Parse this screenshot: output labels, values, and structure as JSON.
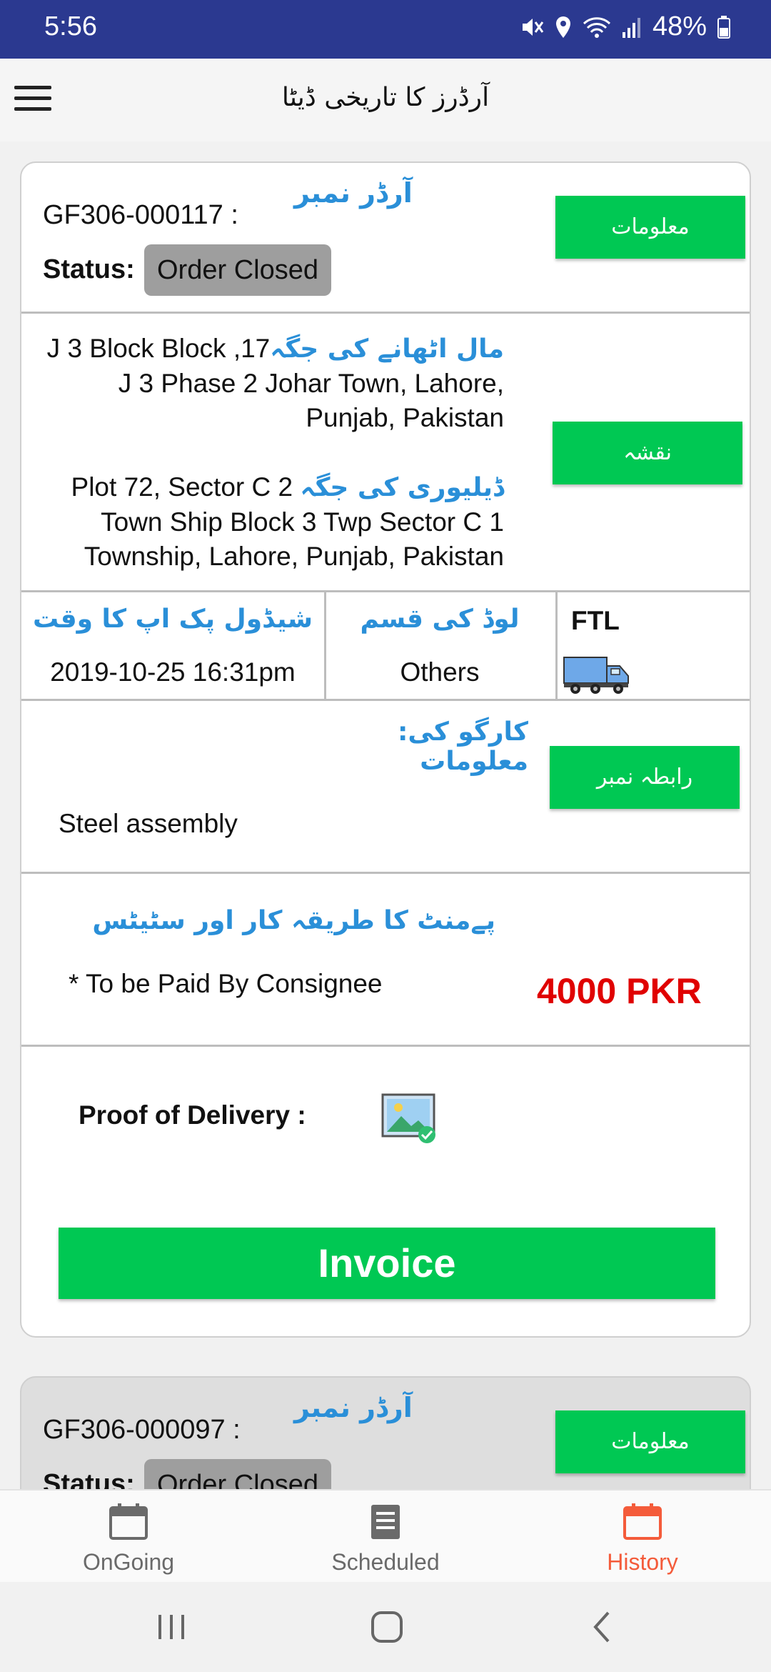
{
  "status_bar": {
    "time": "5:56",
    "battery": "48%"
  },
  "app_bar": {
    "title": "آرڈرز کا تاریخی ڈیٹا",
    "menu_icon": "hamburger-icon"
  },
  "orders": [
    {
      "order_number": "GF306-000117 :",
      "order_label": "آرڈر نمبر",
      "status_label": "Status:",
      "status": "Order Closed",
      "info_button": "معلومات",
      "pickup_label": "مال اٹھانے کی جگہ",
      "pickup_line1": "J 3 Block Block ,17",
      "pickup_line2": "J 3 Phase 2 Johar Town, Lahore,",
      "pickup_line3": "Punjab, Pakistan",
      "delivery_label": "ڈیلیوری کی جگہ",
      "delivery_line1": "Plot 72, Sector C 2",
      "delivery_line2": "Town Ship Block 3 Twp Sector C 1",
      "delivery_line3": "Township, Lahore, Punjab, Pakistan",
      "map_button": "نقشہ",
      "schedule_label": "شیڈول پک اپ کا وقت",
      "schedule_value": "2019-10-25 16:31pm",
      "load_type_label": "لوڈ کی قسم",
      "load_type_value": "Others",
      "vehicle_type": "FTL",
      "cargo_label_1": ":کارگو کی",
      "cargo_label_2": "معلومات",
      "cargo_value": "Steel assembly",
      "contact_button": "رابطہ نمبر",
      "payment_label": "پےمنٹ کا طریقہ کار اور سٹیٹس",
      "payment_method": "* To be Paid By Consignee",
      "amount": "4000 PKR",
      "pod_label": "Proof of Delivery :",
      "invoice_button": "Invoice"
    },
    {
      "order_number": "GF306-000097 :",
      "order_label": "آرڈر نمبر",
      "status_label": "Status:",
      "status": "Order Closed",
      "info_button": "معلومات"
    }
  ],
  "bottom_nav": [
    {
      "label": "OnGoing",
      "icon": "calendar-icon",
      "active": false
    },
    {
      "label": "Scheduled",
      "icon": "list-icon",
      "active": false
    },
    {
      "label": "History",
      "icon": "calendar-icon",
      "active": true
    }
  ],
  "colors": {
    "primary_bar": "#2b3990",
    "accent_green": "#00c853",
    "urdu_blue": "#2a8fd8",
    "price_red": "#e00000",
    "active_tab": "#f45b3a"
  }
}
